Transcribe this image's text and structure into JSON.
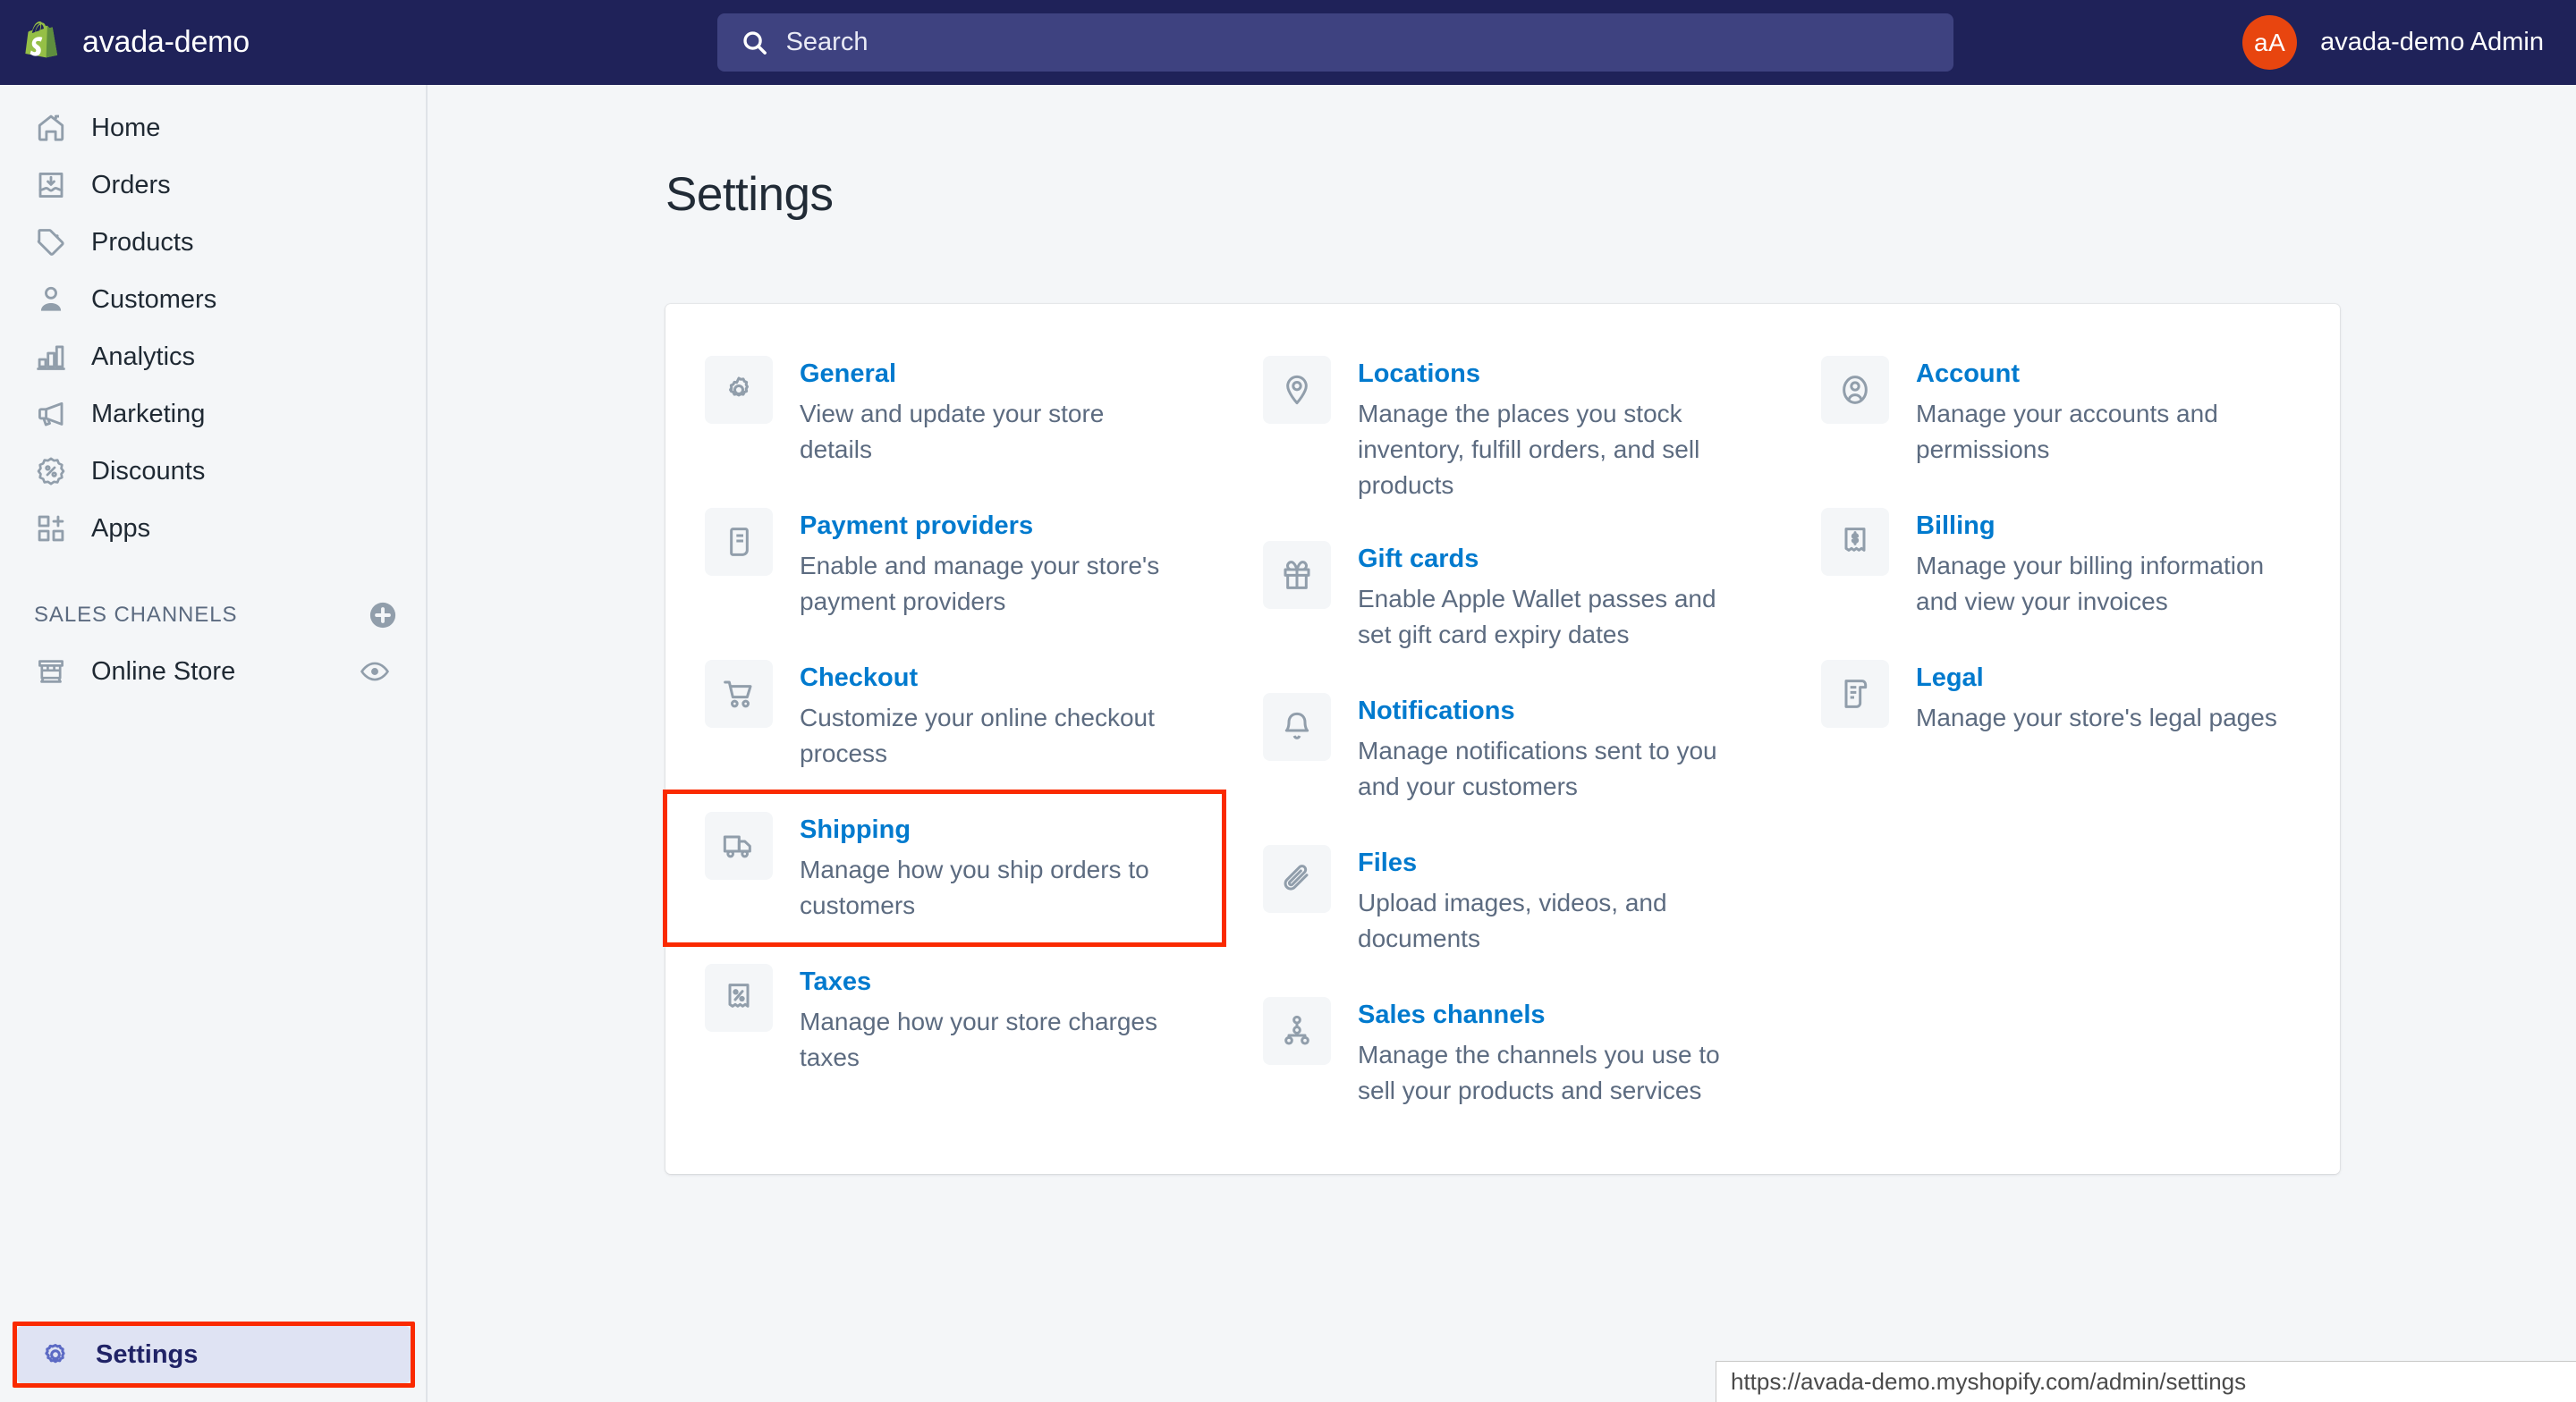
{
  "topbar": {
    "brand_name": "avada-demo",
    "logo_icon": "shopify-bag-icon",
    "search": {
      "placeholder": "Search",
      "icon": "search-icon",
      "value": ""
    },
    "user": {
      "initials": "aA",
      "name": "avada-demo Admin",
      "avatar_color": "#E8450F"
    }
  },
  "sidebar": {
    "nav": [
      {
        "label": "Home",
        "icon": "home-icon"
      },
      {
        "label": "Orders",
        "icon": "orders-inbox-icon"
      },
      {
        "label": "Products",
        "icon": "product-tag-icon"
      },
      {
        "label": "Customers",
        "icon": "customer-person-icon"
      },
      {
        "label": "Analytics",
        "icon": "analytics-bar-chart-icon"
      },
      {
        "label": "Marketing",
        "icon": "marketing-megaphone-icon"
      },
      {
        "label": "Discounts",
        "icon": "discount-percent-badge-icon"
      },
      {
        "label": "Apps",
        "icon": "apps-grid-plus-icon"
      }
    ],
    "sales_channels": {
      "title": "SALES CHANNELS",
      "add_icon": "plus-circle-icon",
      "items": [
        {
          "label": "Online Store",
          "icon": "online-store-icon",
          "action_icon": "eye-icon"
        }
      ]
    },
    "settings": {
      "label": "Settings",
      "icon": "gear-icon",
      "active": true,
      "highlighted": true
    }
  },
  "main": {
    "page_title": "Settings",
    "columns": [
      [
        {
          "title": "General",
          "desc": "View and update your store details",
          "icon": "gear-icon"
        },
        {
          "title": "Payment providers",
          "desc": "Enable and manage your store's payment providers",
          "icon": "payment-card-icon"
        },
        {
          "title": "Checkout",
          "desc": "Customize your online checkout process",
          "icon": "shopping-cart-icon"
        },
        {
          "title": "Shipping",
          "desc": "Manage how you ship orders to customers",
          "icon": "delivery-truck-icon",
          "highlighted": true
        },
        {
          "title": "Taxes",
          "desc": "Manage how your store charges taxes",
          "icon": "tax-receipt-percent-icon"
        }
      ],
      [
        {
          "title": "Locations",
          "desc": "Manage the places you stock inventory, fulfill orders, and sell products",
          "icon": "location-pin-icon"
        },
        {
          "title": "Gift cards",
          "desc": "Enable Apple Wallet passes and set gift card expiry dates",
          "icon": "gift-box-icon"
        },
        {
          "title": "Notifications",
          "desc": "Manage notifications sent to you and your customers",
          "icon": "bell-icon"
        },
        {
          "title": "Files",
          "desc": "Upload images, videos, and documents",
          "icon": "paperclip-icon"
        },
        {
          "title": "Sales channels",
          "desc": "Manage the channels you use to sell your products and services",
          "icon": "sales-channels-nodes-icon"
        }
      ],
      [
        {
          "title": "Account",
          "desc": "Manage your accounts and permissions",
          "icon": "account-avatar-icon"
        },
        {
          "title": "Billing",
          "desc": "Manage your billing information and view your invoices",
          "icon": "billing-receipt-icon"
        },
        {
          "title": "Legal",
          "desc": "Manage your store's legal pages",
          "icon": "legal-scroll-icon"
        }
      ]
    ]
  },
  "statusbar": {
    "url": "https://avada-demo.myshopify.com/admin/settings"
  },
  "colors": {
    "topbar_bg": "#1F2259",
    "search_bg": "#3E4280",
    "link_blue": "#007ACE",
    "highlight_red": "#FA2A00",
    "active_nav_bg": "#DFE3F3",
    "page_bg": "#F4F6F8"
  }
}
